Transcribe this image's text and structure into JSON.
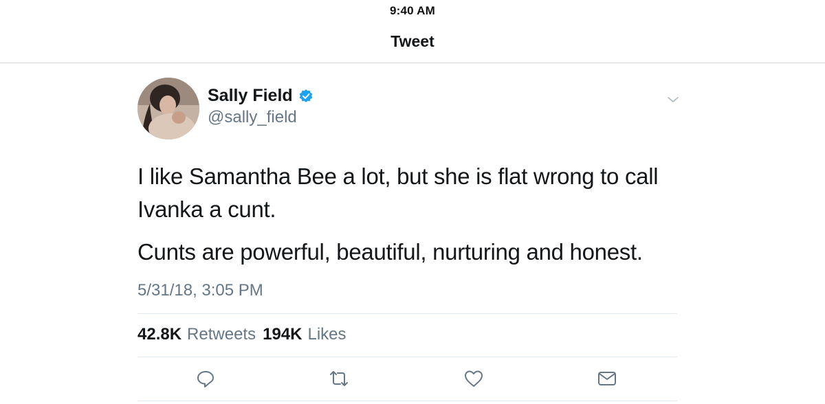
{
  "status_bar": {
    "time": "9:40 AM"
  },
  "nav": {
    "title": "Tweet"
  },
  "author": {
    "name": "Sally Field",
    "handle": "@sally_field",
    "verified": true
  },
  "tweet": {
    "lines": [
      "I like Samantha Bee a lot, but she is flat wrong to call",
      "Ivanka a cunt.",
      "Cunts are powerful, beautiful, nurturing and honest."
    ],
    "timestamp": "5/31/18, 3:05 PM"
  },
  "stats": {
    "retweets_count": "42.8K",
    "retweets_label": "Retweets",
    "likes_count": "194K",
    "likes_label": "Likes"
  },
  "actions": [
    "reply-icon",
    "retweet-icon",
    "like-icon",
    "direct-message-icon"
  ],
  "colors": {
    "text": "#14171a",
    "secondary": "#657786",
    "verified": "#1da1f2",
    "divider": "#e1e8ed"
  }
}
